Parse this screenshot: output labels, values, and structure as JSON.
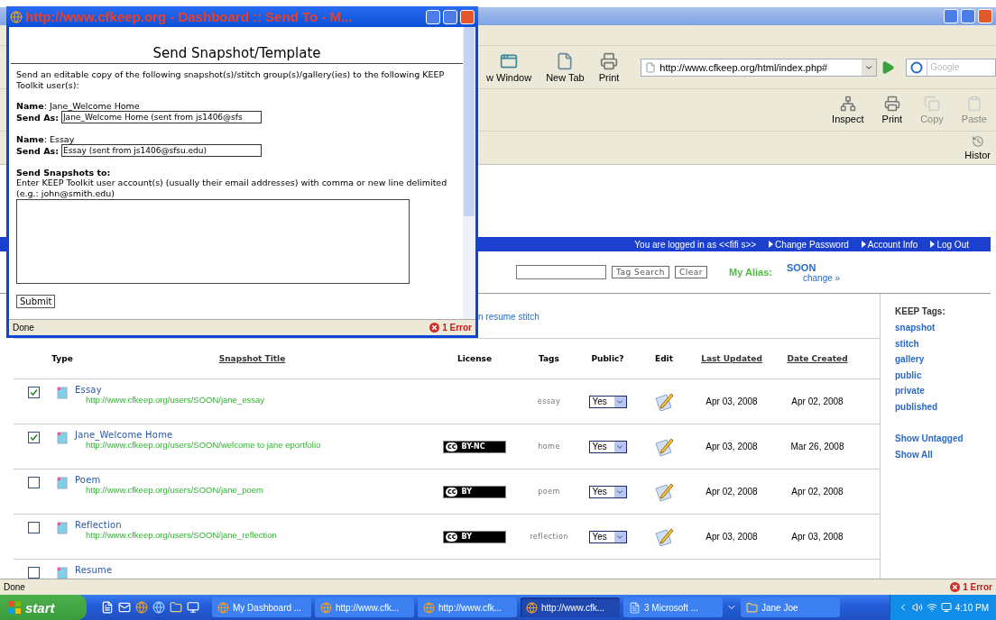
{
  "browser": {
    "nav_toolbar": [
      {
        "label": "w Window",
        "kind": "window"
      },
      {
        "label": "New Tab",
        "kind": "tab"
      },
      {
        "label": "Print",
        "kind": "print"
      }
    ],
    "address": "http://www.cfkeep.org/html/index.php#",
    "search_placeholder": "Google",
    "tools_toolbar": [
      {
        "label": "Inspect",
        "kind": "inspect",
        "disabled": false
      },
      {
        "label": "Print",
        "kind": "print",
        "disabled": false
      },
      {
        "label": "Copy",
        "kind": "copy",
        "disabled": true
      },
      {
        "label": "Paste",
        "kind": "paste",
        "disabled": true
      }
    ],
    "history_label": "Histor",
    "status": {
      "text": "Done",
      "error": "1 Error"
    }
  },
  "page": {
    "user_bar": {
      "logged_in": "You are logged in as <<fifi s>>",
      "links": [
        "Change Password",
        "Account Info",
        "Log Out"
      ]
    },
    "tag_search": {
      "button": "Tag Search",
      "clear": "Clear"
    },
    "alias": {
      "label": "My Alias:",
      "value": "SOON",
      "change": "change »"
    },
    "stitch_link": "n resume stitch",
    "table": {
      "columns": [
        {
          "label": "Type",
          "sortable": false
        },
        {
          "label": "Snapshot Title",
          "sortable": true
        },
        {
          "label": "License",
          "sortable": false
        },
        {
          "label": "Tags",
          "sortable": false
        },
        {
          "label": "Public?",
          "sortable": false
        },
        {
          "label": "Edit",
          "sortable": false
        },
        {
          "label": "Last Updated",
          "sortable": true
        },
        {
          "label": "Date Created",
          "sortable": true
        }
      ],
      "rows": [
        {
          "checked": true,
          "title": "Essay",
          "url": "http://www.cfkeep.org/users/SOON/jane_essay",
          "tags": "essay",
          "public": "Yes",
          "last_updated": "Apr 03, 2008",
          "date_created": "Apr 02, 2008"
        },
        {
          "checked": true,
          "title": "Jane_Welcome Home",
          "url": "http://www.cfkeep.org/users/SOON/welcome to jane eportfolio",
          "license": {
            "mark": "cc",
            "terms": "BY-NC"
          },
          "tags": "home",
          "public": "Yes",
          "last_updated": "Apr 03, 2008",
          "date_created": "Mar 26, 2008"
        },
        {
          "checked": false,
          "title": "Poem",
          "url": "http://www.cfkeep.org/users/SOON/jane_poem",
          "license": {
            "mark": "cc",
            "terms": "BY"
          },
          "tags": "poem",
          "public": "Yes",
          "last_updated": "Apr 02, 2008",
          "date_created": "Apr 02, 2008"
        },
        {
          "checked": false,
          "title": "Reflection",
          "url": "http://www.cfkeep.org/users/SOON/jane_reflection",
          "license": {
            "mark": "cc",
            "terms": "BY"
          },
          "tags": "reflection",
          "public": "Yes",
          "last_updated": "Apr 03, 2008",
          "date_created": "Apr 03, 2008"
        },
        {
          "checked": false,
          "title": "Resume"
        }
      ]
    },
    "sidebar": {
      "title": "KEEP Tags:",
      "tags": [
        "snapshot",
        "stitch",
        "gallery",
        "public",
        "private",
        "published"
      ],
      "links": [
        "Show Untagged",
        "Show All"
      ]
    }
  },
  "popup": {
    "title": "http://www.cfkeep.org - Dashboard :: Send To - M...",
    "heading": "Send Snapshot/Template",
    "intro": "Send an editable copy of the following snapshot(s)/stitch group(s)/gallery(ies) to the following KEEP Toolkit user(s):",
    "entries": [
      {
        "name": "**Name**: Jane_Welcome Home",
        "send_as_label": "Send As:",
        "value": "Jane_Welcome Home (sent from js1406@sfs"
      },
      {
        "name": "**Name**: Essay",
        "send_as_label": "Send As:",
        "value": "Essay (sent from js1406@sfsu.edu)"
      }
    ],
    "recipients_heading": "Send Snapshots to:",
    "recipients_hint": "Enter KEEP Toolkit user account(s) (usually their email addresses) with comma or new line delimited (e.g.: john@smith.edu)",
    "submit": "Submit",
    "status": {
      "text": "Done",
      "error": "1 Error"
    }
  },
  "taskbar": {
    "start": "start",
    "tasks": [
      {
        "label": "My Dashboard ...",
        "kind": "firefox",
        "selected": false
      },
      {
        "label": "http://www.cfk...",
        "kind": "firefox",
        "selected": false
      },
      {
        "label": "http://www.cfk...",
        "kind": "firefox",
        "selected": false
      },
      {
        "label": "http://www.cfk...",
        "kind": "firefox",
        "selected": true
      },
      {
        "label": "3 Microsoft ...",
        "kind": "word",
        "selected": false
      },
      {
        "label": "Jane Joe",
        "kind": "folder",
        "selected": false
      }
    ],
    "clock": "4:10 PM"
  }
}
